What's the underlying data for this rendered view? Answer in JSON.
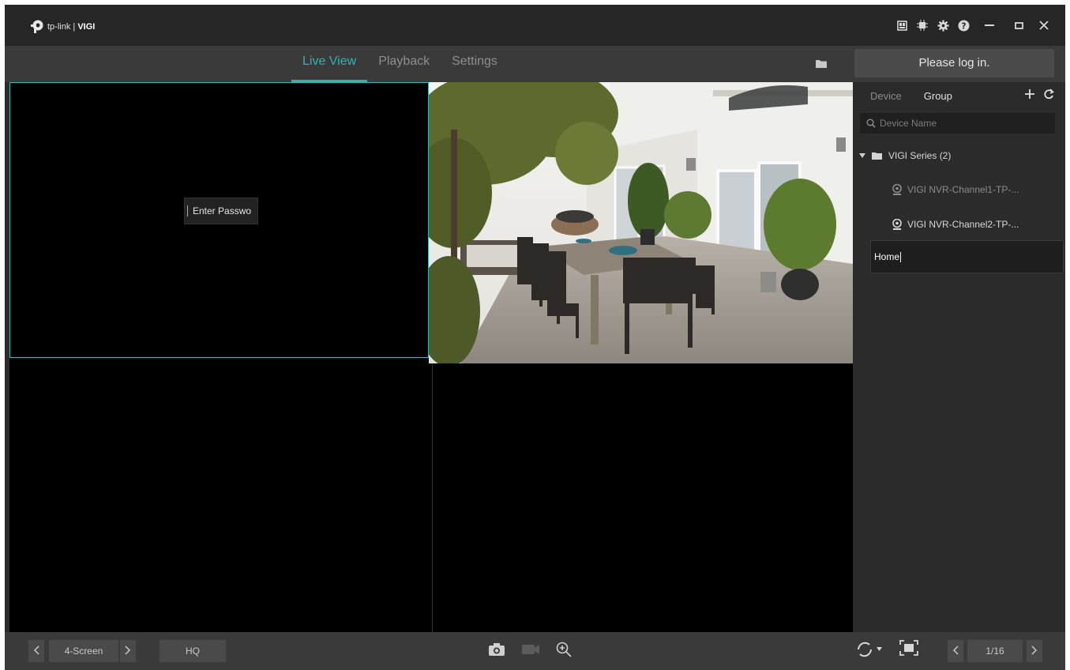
{
  "app": {
    "brand_left": "tp-link",
    "brand_sep": "|",
    "brand_right": "VIGI"
  },
  "nav": {
    "tabs": [
      {
        "label": "Live View",
        "active": true
      },
      {
        "label": "Playback",
        "active": false
      },
      {
        "label": "Settings",
        "active": false
      }
    ],
    "login_label": "Please log in."
  },
  "video": {
    "pane1_prompt": "Enter Passwo"
  },
  "side": {
    "tabs": [
      {
        "label": "Device",
        "active": false
      },
      {
        "label": "Group",
        "active": true
      }
    ],
    "search_placeholder": "Device Name",
    "group_label": "VIGI Series (2)",
    "channels": [
      "VIGI NVR-Channel1-TP-...",
      "VIGI NVR-Channel2-TP-..."
    ],
    "rename_value": "Home"
  },
  "bottom": {
    "layout_label": "4-Screen",
    "quality_label": "HQ",
    "page_label": "1/16"
  },
  "colors": {
    "accent": "#2fb5b1",
    "titlebar": "#262626",
    "navbar": "#3a3a3a",
    "panel": "#2b2b2b"
  },
  "icons": [
    "tp-link-logo-icon",
    "layout-icon",
    "cpu-icon",
    "gear-icon",
    "help-icon",
    "minimize-icon",
    "maximize-icon",
    "close-icon",
    "folder-icon",
    "plus-icon",
    "refresh-icon",
    "search-icon",
    "caret-down-icon",
    "camera-icon",
    "snapshot-icon",
    "record-icon",
    "zoom-icon",
    "cycle-icon",
    "fullscreen-icon"
  ]
}
